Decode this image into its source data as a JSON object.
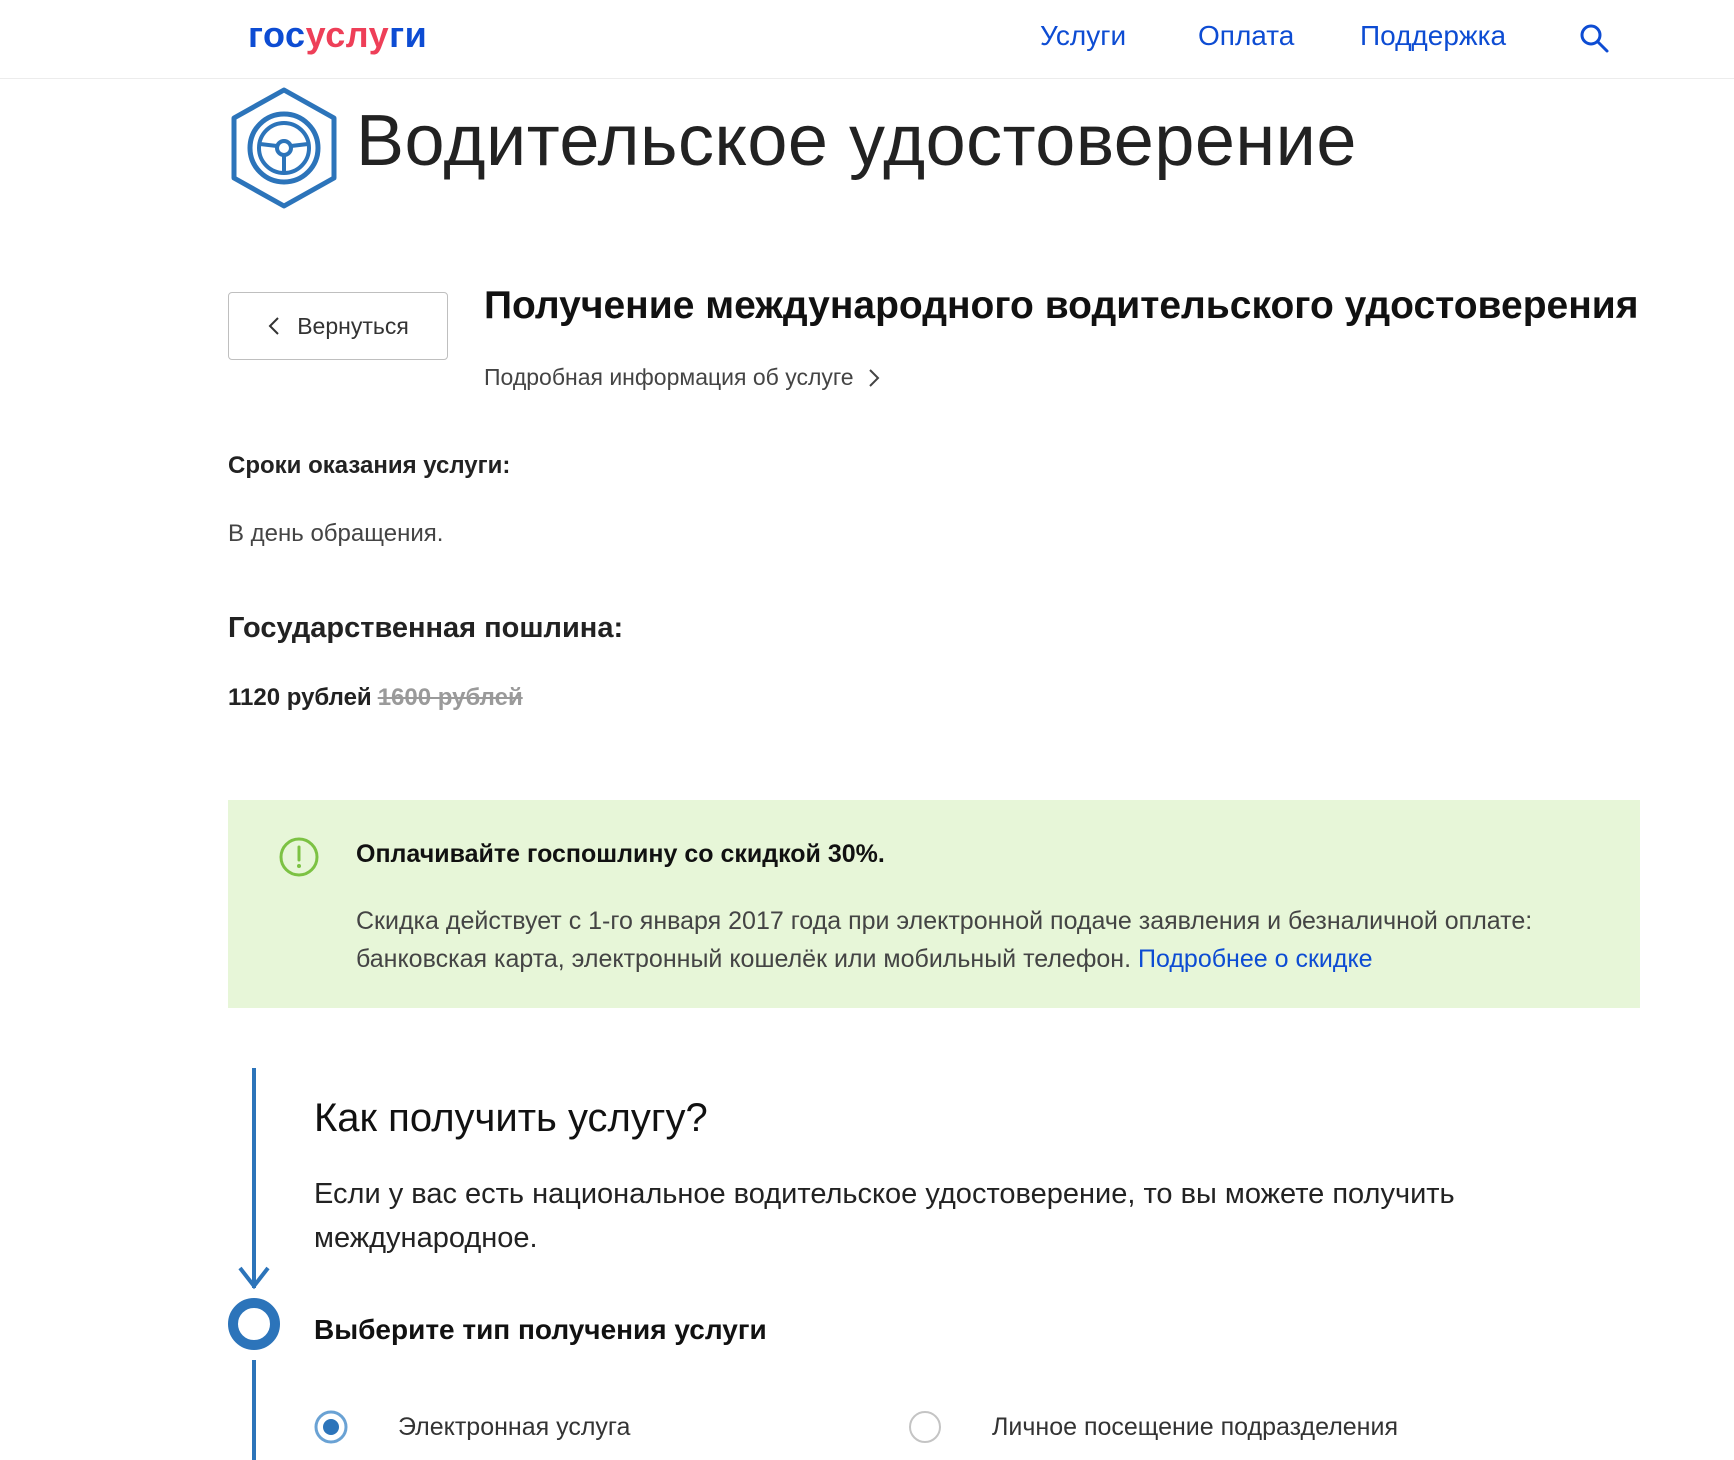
{
  "header": {
    "logo": {
      "gos": "гос",
      "usl": "услу",
      "ru": "ги"
    },
    "nav": [
      {
        "label": "Услуги"
      },
      {
        "label": "Оплата"
      },
      {
        "label": "Поддержка"
      }
    ],
    "search_icon": "search-icon"
  },
  "page": {
    "icon": "steering-wheel-icon",
    "title": "Водительское удостоверение"
  },
  "service": {
    "back_label": "Вернуться",
    "title": "Получение международного водительского удостоверения",
    "details_link": "Подробная информация об услуге"
  },
  "terms": {
    "label": "Сроки оказания услуги:",
    "value": "В день обращения."
  },
  "fee": {
    "label": "Государственная пошлина:",
    "price": "1120 рублей",
    "old_price": "1600 рублей"
  },
  "promo": {
    "icon": "exclamation-circle-icon",
    "title": "Оплачивайте госпошлину со скидкой 30%.",
    "text": "Скидка действует с 1-го января 2017 года при электронной подаче заявления и безналичной оплате: банковская карта, электронный кошелёк или мобильный телефон.",
    "link": "Подробнее о скидке"
  },
  "how": {
    "title": "Как получить услугу?",
    "text": "Если у вас есть национальное водительское удостоверение, то вы можете получить международное.",
    "step_title": "Выберите тип получения услуги",
    "options": [
      {
        "label": "Электронная услуга",
        "selected": true
      },
      {
        "label": "Личное посещение подразделения",
        "selected": false
      }
    ]
  },
  "colors": {
    "brand_blue": "#0d4cd3",
    "brand_red": "#ee3f58",
    "icon_blue": "#2c74ba",
    "promo_bg": "#e7f6d8",
    "promo_icon": "#7cc243"
  }
}
